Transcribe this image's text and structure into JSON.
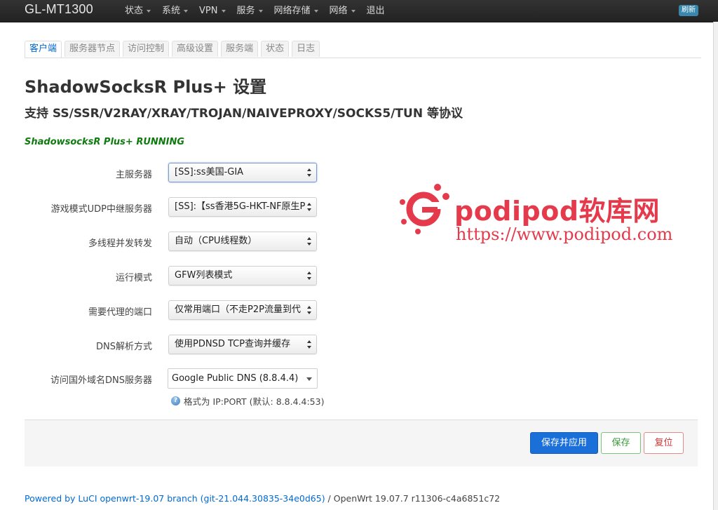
{
  "navbar": {
    "brand": "GL-MT1300",
    "menu": [
      {
        "label": "状态",
        "dropdown": true
      },
      {
        "label": "系统",
        "dropdown": true
      },
      {
        "label": "VPN",
        "dropdown": true
      },
      {
        "label": "服务",
        "dropdown": true
      },
      {
        "label": "网络存储",
        "dropdown": true
      },
      {
        "label": "网络",
        "dropdown": true
      },
      {
        "label": "退出",
        "dropdown": false
      }
    ],
    "refresh_badge": "刷新"
  },
  "tabs": [
    {
      "label": "客户端",
      "active": true
    },
    {
      "label": "服务器节点",
      "active": false
    },
    {
      "label": "访问控制",
      "active": false
    },
    {
      "label": "高级设置",
      "active": false
    },
    {
      "label": "服务端",
      "active": false
    },
    {
      "label": "状态",
      "active": false
    },
    {
      "label": "日志",
      "active": false
    }
  ],
  "page": {
    "title": "ShadowSocksR Plus+ 设置",
    "subtitle": "支持 SS/SSR/V2RAY/XRAY/TROJAN/NAIVEPROXY/SOCKS5/TUN 等协议",
    "status": "ShadowsocksR Plus+ RUNNING"
  },
  "form": {
    "main_server": {
      "label": "主服务器",
      "value": "[SS]:ss美国-GIA"
    },
    "udp_relay": {
      "label": "游戏模式UDP中继服务器",
      "value": "[SS]:【ss香港5G-HKT-NF原生P"
    },
    "threads": {
      "label": "多线程并发转发",
      "value": "自动（CPU线程数）"
    },
    "run_mode": {
      "label": "运行模式",
      "value": "GFW列表模式"
    },
    "proxy_ports": {
      "label": "需要代理的端口",
      "value": "仅常用端口（不走P2P流量到代"
    },
    "dns_mode": {
      "label": "DNS解析方式",
      "value": "使用PDNSD TCP查询并缓存"
    },
    "foreign_dns": {
      "label": "访问国外域名DNS服务器",
      "value": "Google Public DNS (8.8.4.4)",
      "hint": "格式为 IP:PORT (默认: 8.8.4.4:53)"
    }
  },
  "actions": {
    "apply": "保存并应用",
    "save": "保存",
    "reset": "复位"
  },
  "footer": {
    "link": "Powered by LuCI openwrt-19.07 branch (git-21.044.30835-34e0d65)",
    "text": " / OpenWrt 19.07.7 r11306-c4a6851c72"
  },
  "watermark": {
    "brand": "podipod软库网",
    "url": "https://www.podipod.com"
  },
  "colors": {
    "navbar": "#222222",
    "link": "#0069d6",
    "running": "#0f7a0f",
    "primary_button": "#1a6fd8",
    "watermark": "#e43a4b"
  }
}
